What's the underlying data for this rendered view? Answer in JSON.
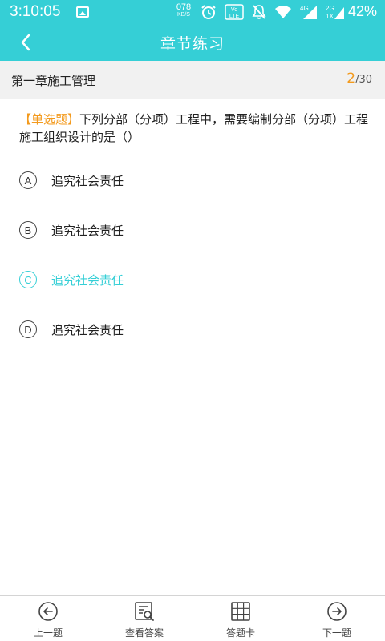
{
  "status_bar": {
    "time": "3:10:05",
    "net_speed_value": "078",
    "net_speed_unit": "KB/S",
    "volte_label": "Vo LTE",
    "net_4g_label": "4G",
    "net_2g_label": "2G",
    "net_1x_label": "1X",
    "battery": "42%"
  },
  "header": {
    "title": "章节练习"
  },
  "chapter": {
    "title": "第一章施工管理",
    "current": "2",
    "total": "/30"
  },
  "question": {
    "type_label": "【单选题】",
    "text": "下列分部（分项）工程中，需要编制分部（分项）工程施工组织设计的是（）"
  },
  "options": [
    {
      "letter": "A",
      "text": "追究社会责任",
      "selected": false
    },
    {
      "letter": "B",
      "text": "追究社会责任",
      "selected": false
    },
    {
      "letter": "C",
      "text": "追究社会责任",
      "selected": true
    },
    {
      "letter": "D",
      "text": "追究社会责任",
      "selected": false
    }
  ],
  "bottom_nav": [
    {
      "label": "上一题",
      "icon": "arrow-left-circle-icon"
    },
    {
      "label": "查看答案",
      "icon": "answer-search-icon"
    },
    {
      "label": "答题卡",
      "icon": "grid-card-icon"
    },
    {
      "label": "下一题",
      "icon": "arrow-right-circle-icon"
    }
  ],
  "colors": {
    "accent": "#35cfd6",
    "highlight": "#f39a1d"
  }
}
